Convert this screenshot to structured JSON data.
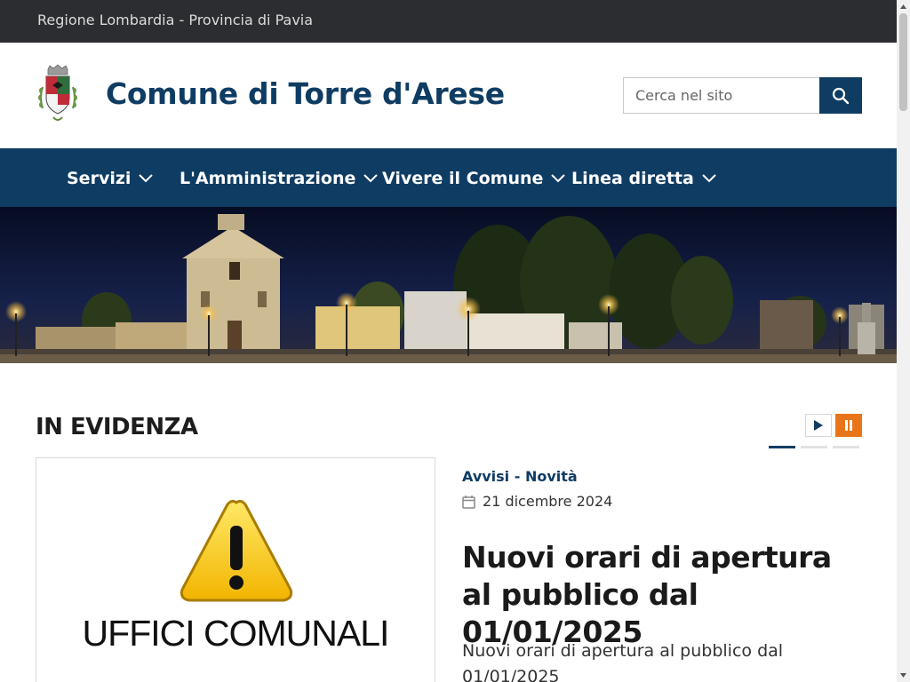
{
  "topbar": {
    "region_text": "Regione Lombardia - Provincia di Pavia"
  },
  "header": {
    "site_title": "Comune di Torre d'Arese",
    "search": {
      "placeholder": "Cerca nel sito",
      "value": ""
    }
  },
  "nav": {
    "items": [
      {
        "label": "Servizi"
      },
      {
        "label": "L'Amministrazione"
      },
      {
        "label": "Vivere il Comune"
      },
      {
        "label": "Linea diretta"
      }
    ]
  },
  "section": {
    "title": "IN EVIDENZA",
    "carousel": {
      "slide_count": 3,
      "active_index": 0,
      "state": "playing"
    }
  },
  "article": {
    "image_caption": "UFFICI COMUNALI",
    "category": "Avvisi - Novità",
    "date": "21 dicembre 2024",
    "title": "Nuovi orari di apertura al pubblico dal 01/01/2025",
    "summary": "Nuovi orari di apertura al pubblico dal 01/01/2025"
  },
  "colors": {
    "brand_blue": "#0f3c63",
    "topbar_dark": "#2b2d30",
    "accent_orange": "#e8751a"
  },
  "icons": {
    "search": "search-icon",
    "nav_dropdown": "chevron-down-icon",
    "play": "play-icon",
    "pause": "pause-icon",
    "calendar": "calendar-icon",
    "warning": "warning-icon",
    "coat_of_arms": "coat-of-arms-logo"
  }
}
